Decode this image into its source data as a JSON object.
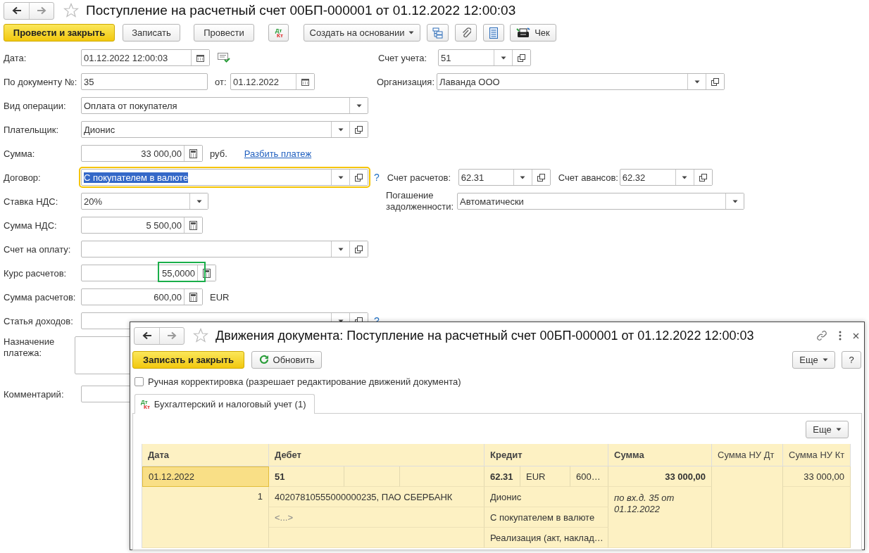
{
  "window": {
    "title": "Поступление на расчетный счет 00БП-000001 от 01.12.2022 12:00:03"
  },
  "toolbar": [
    {
      "kind": "primary",
      "label": "Провести и закрыть"
    },
    {
      "kind": "plain",
      "label": "Записать"
    },
    {
      "kind": "plain",
      "label": "Провести"
    },
    {
      "kind": "dtkt",
      "top": "Дт",
      "bottom": "Кт"
    },
    {
      "kind": "menu",
      "label": "Создать на основании"
    },
    {
      "kind": "structure"
    },
    {
      "kind": "attach"
    },
    {
      "kind": "list"
    },
    {
      "kind": "receipt",
      "label": "Чек"
    }
  ],
  "form": {
    "rows": [
      {
        "label": "Дата:",
        "items": [
          {
            "kind": "date",
            "value": "01.12.2022 12:00:03"
          },
          {
            "kind": "status"
          },
          {
            "kind": "label",
            "text": "Счет учета:"
          },
          {
            "kind": "ref",
            "value": "51"
          }
        ]
      },
      {
        "label": "По документу №:",
        "items": [
          {
            "kind": "text",
            "value": "35"
          },
          {
            "kind": "label",
            "text": "от:"
          },
          {
            "kind": "date",
            "value": "01.12.2022"
          },
          {
            "kind": "label",
            "text": "Организация:"
          },
          {
            "kind": "ref",
            "value": "Лаванда ООО"
          }
        ]
      },
      {
        "label": "Вид операции:",
        "items": [
          {
            "kind": "select",
            "value": "Оплата от покупателя"
          }
        ]
      },
      {
        "label": "Плательщик:",
        "items": [
          {
            "kind": "ref",
            "value": "Дионис"
          }
        ]
      },
      {
        "label": "Сумма:",
        "items": [
          {
            "kind": "number",
            "value": "33 000,00"
          },
          {
            "kind": "unit",
            "text": "руб."
          },
          {
            "kind": "link",
            "text": "Разбить платеж"
          }
        ]
      },
      {
        "label": "Договор:",
        "items": [
          {
            "kind": "ref",
            "value": "С покупателем в валюте",
            "focused": true
          },
          {
            "kind": "help",
            "text": "?"
          },
          {
            "kind": "label",
            "text": "Счет расчетов:"
          },
          {
            "kind": "ref",
            "value": "62.31"
          },
          {
            "kind": "label",
            "text": "Счет авансов:"
          },
          {
            "kind": "ref",
            "value": "62.32"
          }
        ]
      },
      {
        "label": "Ставка НДС:",
        "items": [
          {
            "kind": "select",
            "value": "20%"
          },
          {
            "kind": "label",
            "text": "Погашение задолженности:"
          },
          {
            "kind": "select",
            "value": "Автоматически"
          }
        ]
      },
      {
        "label": "Сумма НДС:",
        "items": [
          {
            "kind": "number",
            "value": "5 500,00"
          }
        ]
      },
      {
        "label": "Счет на оплату:",
        "items": [
          {
            "kind": "ref",
            "value": ""
          }
        ]
      },
      {
        "label": "Курс расчетов:",
        "items": [
          {
            "kind": "number",
            "value": "55,0000",
            "highlighted": true
          }
        ]
      },
      {
        "label": "Сумма расчетов:",
        "items": [
          {
            "kind": "number",
            "value": "600,00"
          },
          {
            "kind": "unit",
            "text": "EUR"
          }
        ]
      },
      {
        "label": "Статья доходов:",
        "items": [
          {
            "kind": "ref",
            "value": ""
          },
          {
            "kind": "help",
            "text": "?"
          }
        ]
      },
      {
        "label": "Назначение платежа:",
        "items": [
          {
            "kind": "textarea",
            "value": ""
          }
        ]
      },
      {
        "label": "Комментарий:",
        "items": [
          {
            "kind": "text",
            "value": ""
          }
        ]
      }
    ]
  },
  "dialog": {
    "title": "Движения документа: Поступление на расчетный счет 00БП-000001 от 01.12.2022 12:00:03",
    "toolbar": [
      {
        "kind": "primary",
        "label": "Записать и закрыть"
      },
      {
        "kind": "refresh",
        "label": "Обновить"
      }
    ],
    "toolbar_right": [
      {
        "kind": "menu",
        "label": "Еще"
      },
      {
        "kind": "plain",
        "label": "?"
      }
    ],
    "manual_edit": {
      "label": "Ручная корректировка (разрешает редактирование движений документа)",
      "checked": false
    },
    "tabs": [
      {
        "label": "Бухгалтерский и налоговый учет (1)",
        "top": "Дт",
        "bottom": "Кт",
        "selected": true
      }
    ],
    "panel_menu": {
      "label": "Еще"
    },
    "table": {
      "columns": [
        "Дата",
        "Дебет",
        "Кредит",
        "Сумма",
        "Сумма НУ Дт",
        "Сумма НУ Кт"
      ],
      "rows": [
        {
          "selected": true,
          "date": "01.12.2022",
          "number": "1",
          "debit": {
            "account": "51",
            "lines": [
              "40207810555000000235, ПАО СБЕРБАНК",
              "<...>"
            ]
          },
          "credit": {
            "account": "62.31",
            "currency": "EUR",
            "amount": "600…",
            "lines": [
              "Дионис",
              "С покупателем в валюте",
              "Реализация (акт, наклад…"
            ]
          },
          "sum": "33 000,00",
          "sum_note": "по вх.д. 35 от 01.12.2022",
          "nu_kt": "33 000,00"
        }
      ]
    }
  }
}
